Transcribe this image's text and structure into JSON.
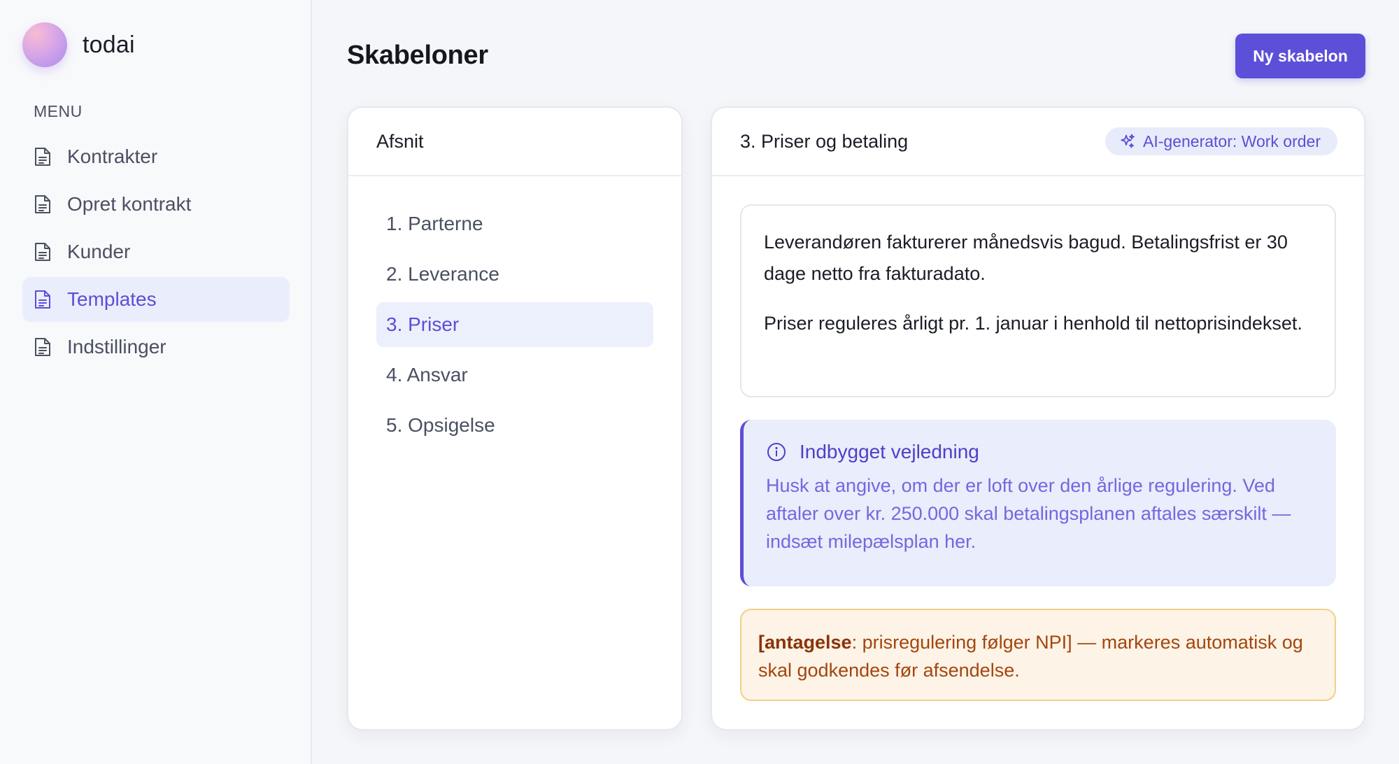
{
  "brand": {
    "name": "todai"
  },
  "sidebar": {
    "menu_heading": "MENU",
    "items": [
      {
        "label": "Kontrakter",
        "icon": "document-icon",
        "active": false
      },
      {
        "label": "Opret kontrakt",
        "icon": "document-icon",
        "active": false
      },
      {
        "label": "Kunder",
        "icon": "document-icon",
        "active": false
      },
      {
        "label": "Templates",
        "icon": "document-icon",
        "active": true
      },
      {
        "label": "Indstillinger",
        "icon": "document-icon",
        "active": false
      }
    ]
  },
  "header": {
    "title": "Skabeloner",
    "new_button_label": "Ny skabelon"
  },
  "sections_panel": {
    "title": "Afsnit",
    "items": [
      {
        "label": "1. Parterne",
        "active": false
      },
      {
        "label": "2. Leverance",
        "active": false
      },
      {
        "label": "3. Priser",
        "active": true
      },
      {
        "label": "4. Ansvar",
        "active": false
      },
      {
        "label": "5. Opsigelse",
        "active": false
      }
    ]
  },
  "editor": {
    "title": "3. Priser og betaling",
    "ai_badge": "AI-generator: Work order",
    "paragraphs": [
      "Leverandøren fakturerer månedsvis bagud. Betalingsfrist er 30 dage netto fra fakturadato.",
      "Priser reguleres årligt pr. 1. januar i henhold til nettoprisindekset."
    ],
    "guidance": {
      "title": "Indbygget vejledning",
      "text": "Husk at angive, om der er loft over den årlige regulering. Ved aftaler over kr. 250.000 skal betalingsplanen aftales særskilt — indsæt milepælsplan her."
    },
    "assumption": {
      "prefix": "[antagelse",
      "text": ": prisregulering følger NPI] — markeres automatisk og skal godkendes før afsendelse."
    }
  },
  "colors": {
    "accent": "#5c4fd8",
    "active_bg": "#eaeefc",
    "guidance_bg": "#eaedfb",
    "warning_bg": "#fdf3e6",
    "warning_border": "#f2cf8a",
    "warning_text": "#a3460e"
  }
}
